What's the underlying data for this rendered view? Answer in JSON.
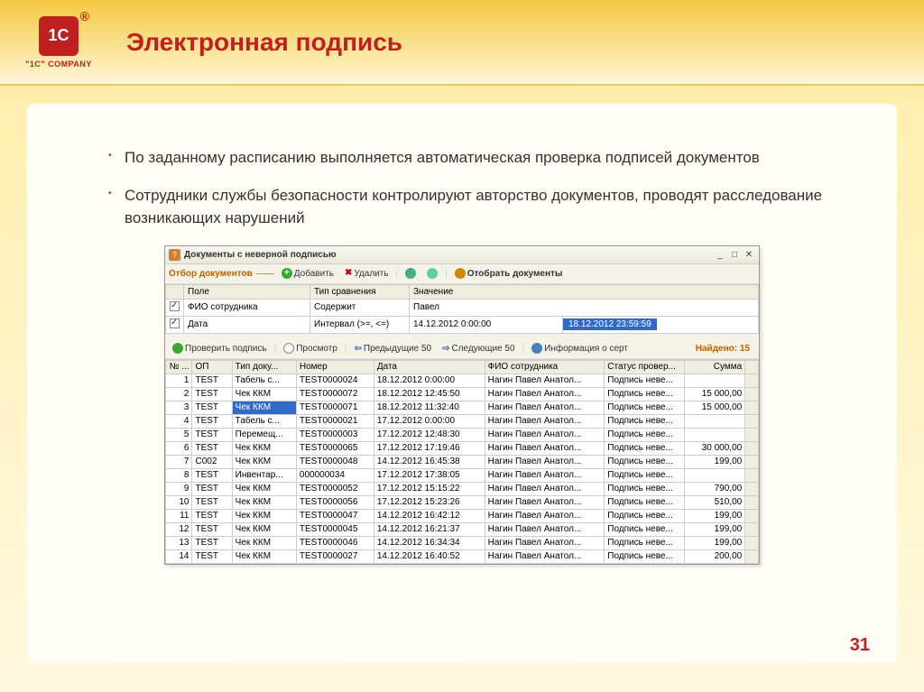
{
  "header": {
    "logo_text": "1С",
    "company": "\"1C\" COMPANY",
    "title": "Электронная подпись"
  },
  "bullets": [
    "По заданному расписанию выполняется автоматическая проверка подписей документов",
    "Сотрудники службы безопасности контролируют авторство документов, проводят расследование возникающих нарушений"
  ],
  "app": {
    "title": "Документы с неверной подписью",
    "toolbar1": {
      "section": "Отбор документов",
      "add": "Добавить",
      "delete": "Удалить",
      "filter": "Отобрать документы"
    },
    "filter": {
      "headers": {
        "field": "Поле",
        "comparison": "Тип сравнения",
        "value": "Значение"
      },
      "rows": [
        {
          "field": "ФИО сотрудника",
          "comparison": "Содержит",
          "value": "Павел",
          "value2": ""
        },
        {
          "field": "Дата",
          "comparison": "Интервал (>=, <=)",
          "value": "14.12.2012 0:00:00",
          "value2": "18.12.2012 23:59:59"
        }
      ]
    },
    "toolbar2": {
      "verify": "Проверить подпись",
      "view": "Просмотр",
      "prev": "Предыдущие 50",
      "next": "Следующие 50",
      "cert": "Информация о серт",
      "found": "Найдено: 15"
    },
    "grid": {
      "headers": {
        "num": "№ ...",
        "op": "ОП",
        "type": "Тип доку...",
        "docnum": "Номер",
        "date": "Дата",
        "fio": "ФИО сотрудника",
        "status": "Статус провер...",
        "sum": "Сумма"
      },
      "rows": [
        {
          "n": "1",
          "op": "TEST",
          "type": "Табель с...",
          "num": "TEST0000024",
          "date": "18.12.2012 0:00:00",
          "fio": "Нагин Павел Анатол...",
          "status": "Подпись неве...",
          "sum": ""
        },
        {
          "n": "2",
          "op": "TEST",
          "type": "Чек ККМ",
          "num": "TEST0000072",
          "date": "18.12.2012 12:45:50",
          "fio": "Нагин Павел Анатол...",
          "status": "Подпись неве...",
          "sum": "15 000,00"
        },
        {
          "n": "3",
          "op": "TEST",
          "type": "Чек ККМ",
          "num": "TEST0000071",
          "date": "18.12.2012 11:32:40",
          "fio": "Нагин Павел Анатол...",
          "status": "Подпись неве...",
          "sum": "15 000,00"
        },
        {
          "n": "4",
          "op": "TEST",
          "type": "Табель с...",
          "num": "TEST0000021",
          "date": "17.12.2012 0:00:00",
          "fio": "Нагин Павел Анатол...",
          "status": "Подпись неве...",
          "sum": ""
        },
        {
          "n": "5",
          "op": "TEST",
          "type": "Перемещ...",
          "num": "TEST0000003",
          "date": "17.12.2012 12:48:30",
          "fio": "Нагин Павел Анатол...",
          "status": "Подпись неве...",
          "sum": ""
        },
        {
          "n": "6",
          "op": "TEST",
          "type": "Чек ККМ",
          "num": "TEST0000065",
          "date": "17.12.2012 17:19:46",
          "fio": "Нагин Павел Анатол...",
          "status": "Подпись неве...",
          "sum": "30 000,00"
        },
        {
          "n": "7",
          "op": "C002",
          "type": "Чек ККМ",
          "num": "TEST0000048",
          "date": "14.12.2012 16:45:38",
          "fio": "Нагин Павел Анатол...",
          "status": "Подпись неве...",
          "sum": "199,00"
        },
        {
          "n": "8",
          "op": "TEST",
          "type": "Инвентар...",
          "num": "000000034",
          "date": "17.12.2012 17:38:05",
          "fio": "Нагин Павел Анатол...",
          "status": "Подпись неве...",
          "sum": ""
        },
        {
          "n": "9",
          "op": "TEST",
          "type": "Чек ККМ",
          "num": "TEST0000052",
          "date": "17.12.2012 15:15:22",
          "fio": "Нагин Павел Анатол...",
          "status": "Подпись неве...",
          "sum": "790,00"
        },
        {
          "n": "10",
          "op": "TEST",
          "type": "Чек ККМ",
          "num": "TEST0000056",
          "date": "17.12.2012 15:23:26",
          "fio": "Нагин Павел Анатол...",
          "status": "Подпись неве...",
          "sum": "510,00"
        },
        {
          "n": "11",
          "op": "TEST",
          "type": "Чек ККМ",
          "num": "TEST0000047",
          "date": "14.12.2012 16:42:12",
          "fio": "Нагин Павел Анатол...",
          "status": "Подпись неве...",
          "sum": "199,00"
        },
        {
          "n": "12",
          "op": "TEST",
          "type": "Чек ККМ",
          "num": "TEST0000045",
          "date": "14.12.2012 16:21:37",
          "fio": "Нагин Павел Анатол...",
          "status": "Подпись неве...",
          "sum": "199,00"
        },
        {
          "n": "13",
          "op": "TEST",
          "type": "Чек ККМ",
          "num": "TEST0000046",
          "date": "14.12.2012 16:34:34",
          "fio": "Нагин Павел Анатол...",
          "status": "Подпись неве...",
          "sum": "199,00"
        },
        {
          "n": "14",
          "op": "TEST",
          "type": "Чек ККМ",
          "num": "TEST0000027",
          "date": "14.12.2012 16:40:52",
          "fio": "Нагин Павел Анатол...",
          "status": "Подпись неве...",
          "sum": "200,00"
        }
      ]
    }
  },
  "page_number": "31"
}
